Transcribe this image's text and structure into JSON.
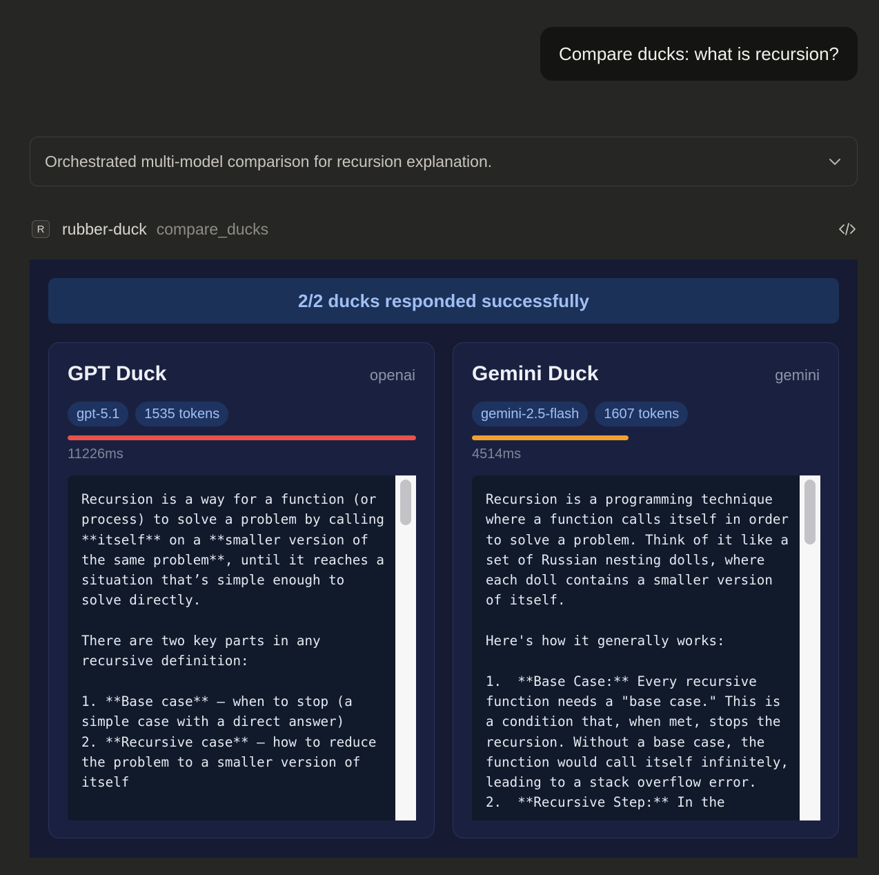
{
  "user_message": "Compare ducks: what is recursion?",
  "summary": {
    "text": "Orchestrated multi-model comparison for recursion explanation.",
    "toggle_icon": "chevron-down-icon"
  },
  "tool": {
    "badge": "R",
    "server": "rubber-duck",
    "name": "compare_ducks",
    "code_icon": "code-icon"
  },
  "result": {
    "banner": "2/2 ducks responded successfully",
    "ducks": [
      {
        "name": "GPT Duck",
        "provider": "openai",
        "model": "gpt-5.1",
        "tokens": "1535 tokens",
        "timing": "11226ms",
        "bar_fraction": 1.0,
        "bar_color": "#e8524a",
        "response": "Recursion is a way for a function (or process) to solve a problem by calling **itself** on a **smaller version of the same problem**, until it reaches a situation that’s simple enough to solve directly.\n\nThere are two key parts in any recursive definition:\n\n1. **Base case** – when to stop (a simple case with a direct answer)\n2. **Recursive case** – how to reduce the problem to a smaller version of itself"
      },
      {
        "name": "Gemini Duck",
        "provider": "gemini",
        "model": "gemini-2.5-flash",
        "tokens": "1607 tokens",
        "timing": "4514ms",
        "bar_fraction": 0.45,
        "bar_color": "#f0a030",
        "response": "Recursion is a programming technique where a function calls itself in order to solve a problem. Think of it like a set of Russian nesting dolls, where each doll contains a smaller version of itself.\n\nHere's how it generally works:\n\n1.  **Base Case:** Every recursive function needs a \"base case.\" This is a condition that, when met, stops the recursion. Without a base case, the function would call itself infinitely, leading to a stack overflow error.\n2.  **Recursive Step:** In the"
      }
    ]
  }
}
